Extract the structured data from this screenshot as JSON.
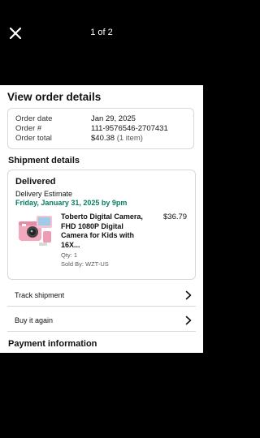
{
  "pager": "1 of 2",
  "title": "View order details",
  "order": {
    "rows": [
      {
        "label": "Order date",
        "value": "Jan 29, 2025"
      },
      {
        "label": "Order #",
        "value": "111-9576546-2707431"
      },
      {
        "label": "Order total",
        "value": "$40.38",
        "extra": "(1 item)"
      }
    ]
  },
  "shipment": {
    "heading": "Shipment details",
    "status": "Delivered",
    "estimate_label": "Delivery Estimate",
    "estimate_date": "Friday, January 31, 2025 by 9pm",
    "item": {
      "name": "Toberto Digital Camera, FHD 1080P Digital Camera for Kids with 16X...",
      "price": "$36.79",
      "qty": "Qty: 1",
      "seller": "Sold By: WZT-US"
    }
  },
  "actions": {
    "track": "Track shipment",
    "buy_again": "Buy it again"
  },
  "payment_heading": "Payment information",
  "colors": {
    "accent_green": "#067d62",
    "border": "#d5d9d9"
  },
  "icons": {
    "close": "close-icon",
    "chevron": "chevron-right-icon"
  }
}
